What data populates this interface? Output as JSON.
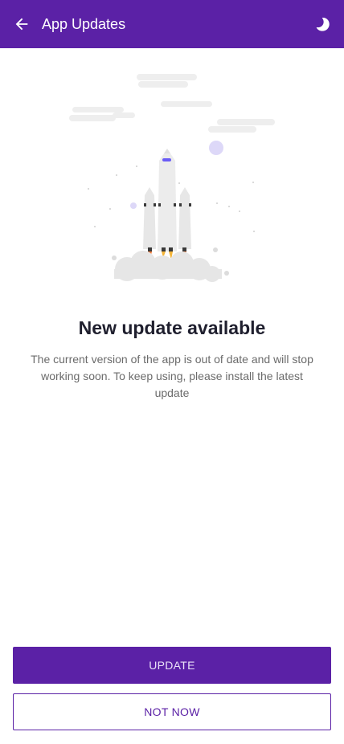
{
  "appbar": {
    "title": "App Updates",
    "back_icon": "arrow-left-icon",
    "theme_icon": "moon-icon"
  },
  "illustration": {
    "icon": "rocket-launch-illustration"
  },
  "content": {
    "headline": "New update available",
    "description": "The current version of the app is out of date and will stop working soon. To keep using, please install the latest update"
  },
  "actions": {
    "update_label": "UPDATE",
    "not_now_label": "NOT NOW"
  },
  "colors": {
    "primary": "#5b21a6",
    "accent": "#6a5cf6"
  }
}
